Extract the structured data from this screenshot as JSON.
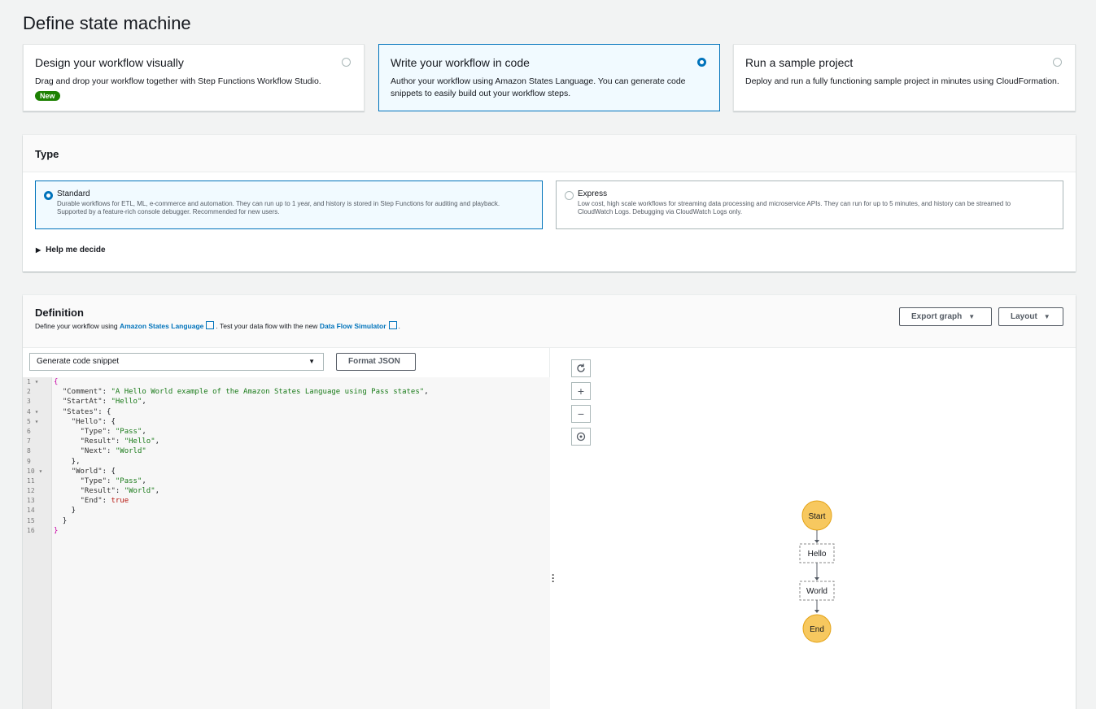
{
  "page_title": "Define state machine",
  "cards": [
    {
      "title": "Design your workflow visually",
      "desc": "Drag and drop your workflow together with Step Functions Workflow Studio.",
      "badge": "New",
      "selected": false
    },
    {
      "title": "Write your workflow in code",
      "desc": "Author your workflow using Amazon States Language. You can generate code snippets to easily build out your workflow steps.",
      "selected": true
    },
    {
      "title": "Run a sample project",
      "desc": "Deploy and run a fully functioning sample project in minutes using CloudFormation.",
      "selected": false
    }
  ],
  "type_section": {
    "title": "Type",
    "options": [
      {
        "label": "Standard",
        "desc": "Durable workflows for ETL, ML, e-commerce and automation. They can run up to 1 year, and history is stored in Step Functions for auditing and playback. Supported by a feature-rich console debugger. Recommended for new users.",
        "selected": true
      },
      {
        "label": "Express",
        "desc": "Low cost, high scale workflows for streaming data processing and microservice APIs. They can run for up to 5 minutes, and history can be streamed to CloudWatch Logs. Debugging via CloudWatch Logs only.",
        "selected": false
      }
    ],
    "help": "Help me decide"
  },
  "definition": {
    "title": "Definition",
    "desc_prefix": "Define your workflow using",
    "link1": "Amazon States Language",
    "desc_middle": ". Test your data flow with the new",
    "link2": "Data Flow Simulator",
    "desc_suffix": ".",
    "export_label": "Export graph",
    "layout_label": "Layout",
    "snippet_select": "Generate code snippet",
    "format_label": "Format JSON",
    "line_numbers": [
      "1 ▾",
      "2",
      "3",
      "4 ▾",
      "5 ▾",
      "6",
      "7",
      "8",
      "9",
      "10 ▾",
      "11",
      "12",
      "13",
      "14",
      "15",
      "16"
    ],
    "graph_controls": [
      "refresh-icon",
      "zoom-in-icon",
      "zoom-out-icon",
      "center-icon"
    ],
    "graph_nodes": {
      "start": "Start",
      "hello": "Hello",
      "world": "World",
      "end": "End"
    }
  },
  "code": {
    "comment_key": "\"Comment\"",
    "comment_val": "\"A Hello World example of the Amazon States Language using Pass states\"",
    "startat_key": "\"StartAt\"",
    "startat_val": "\"Hello\"",
    "states_key": "\"States\"",
    "hello_key": "\"Hello\"",
    "type_key": "\"Type\"",
    "pass_val": "\"Pass\"",
    "result_key": "\"Result\"",
    "hello_result": "\"Hello\"",
    "next_key": "\"Next\"",
    "world_val": "\"World\"",
    "world_key": "\"World\"",
    "world_result": "\"World\"",
    "end_key": "\"End\"",
    "end_val": "true"
  },
  "colors": {
    "accent": "#0073bb",
    "badge": "#1d8102",
    "node_fill": "#f7c85f",
    "node_stroke": "#e4a317"
  }
}
